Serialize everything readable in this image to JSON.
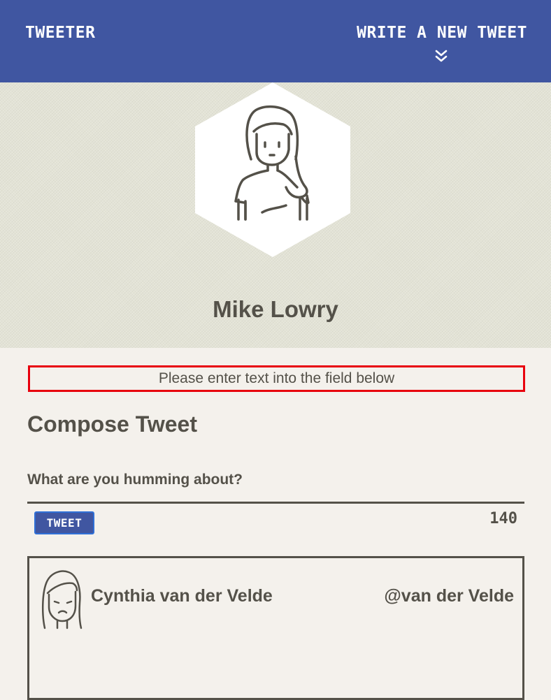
{
  "nav": {
    "brand": "Tweeter",
    "write_link": "Write a new tweet",
    "write_icon": "chevron-double-down-icon"
  },
  "profile": {
    "name": "Mike Lowry",
    "avatar_icon": "user-avatar-icon"
  },
  "error": {
    "message": "Please enter text into the field below",
    "border_color": "#e8000d"
  },
  "compose": {
    "title": "Compose Tweet",
    "placeholder": "What are you humming about?",
    "value": "",
    "button_label": "Tweet",
    "counter": "140"
  },
  "tweets": [
    {
      "name": "Cynthia van der Velde",
      "handle": "@van der Velde",
      "avatar_icon": "user-avatar-icon"
    }
  ],
  "colors": {
    "nav_bg": "#4056a1",
    "page_bg": "#f4f1ec",
    "profile_bg": "#e3e3d6",
    "text": "#545149"
  }
}
